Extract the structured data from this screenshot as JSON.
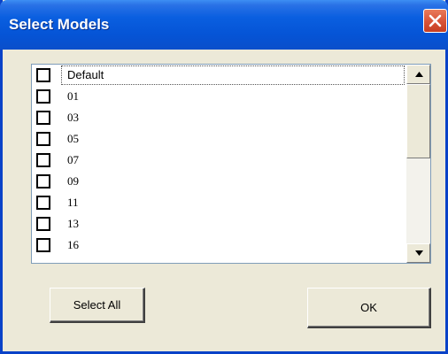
{
  "window": {
    "title": "Select Models",
    "close_icon": "close-icon"
  },
  "list": {
    "items": [
      {
        "label": "Default",
        "checked": false
      },
      {
        "label": "01",
        "checked": false
      },
      {
        "label": "03",
        "checked": false
      },
      {
        "label": "05",
        "checked": false
      },
      {
        "label": "07",
        "checked": false
      },
      {
        "label": "09",
        "checked": false
      },
      {
        "label": "11",
        "checked": false
      },
      {
        "label": "13",
        "checked": false
      },
      {
        "label": "16",
        "checked": false
      }
    ],
    "selected_index": 0
  },
  "buttons": {
    "select_all": "Select All",
    "ok": "OK"
  },
  "colors": {
    "titlebar": "#0554d6",
    "close_button": "#d9553a",
    "dialog_bg": "#ece9d8"
  }
}
